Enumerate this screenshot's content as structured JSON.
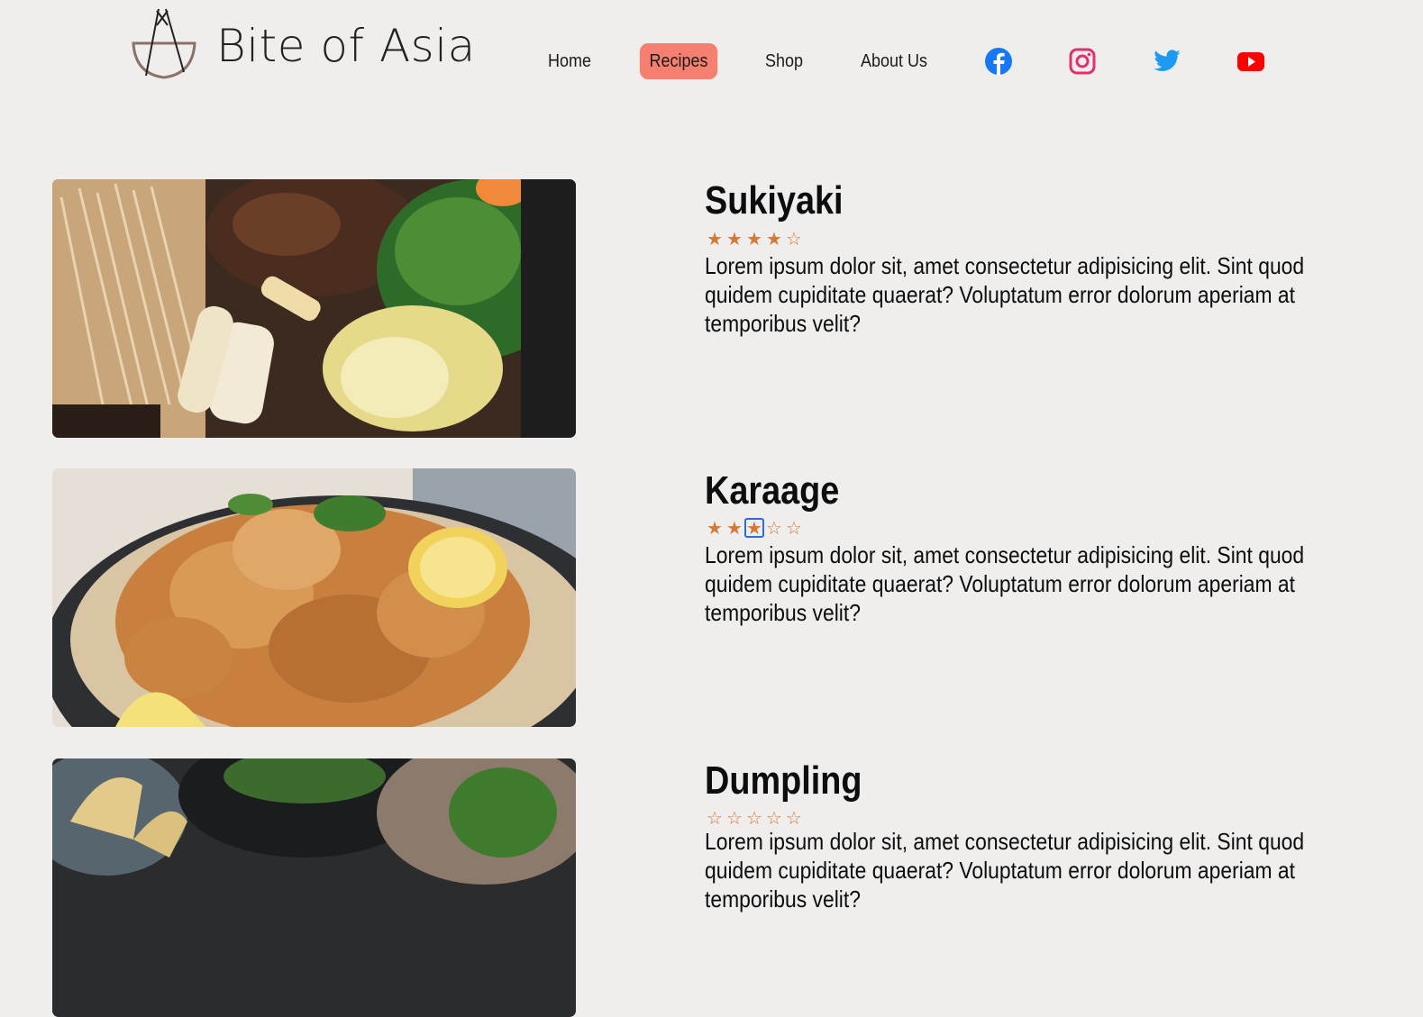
{
  "brand": {
    "name": "Bite of Asia"
  },
  "nav": {
    "items": [
      {
        "label": "Home"
      },
      {
        "label": "Recipes",
        "active": true
      },
      {
        "label": "Shop"
      },
      {
        "label": "About Us"
      }
    ]
  },
  "social": [
    "facebook-icon",
    "instagram-icon",
    "twitter-icon",
    "youtube-icon"
  ],
  "colors": {
    "accent": "#f5806f",
    "star": "#d07a3c",
    "background": "#efeeed"
  },
  "recipes": [
    {
      "title": "Sukiyaki",
      "rating": 4,
      "max_rating": 5,
      "description": "Lorem ipsum dolor sit, amet consectetur adipisicing elit. Sint quod quidem cupiditate quaerat? Voluptatum error dolorum aperiam at temporibus velit?"
    },
    {
      "title": "Karaage",
      "rating": 3,
      "max_rating": 5,
      "description": "Lorem ipsum dolor sit, amet consectetur adipisicing elit. Sint quod quidem cupiditate quaerat? Voluptatum error dolorum aperiam at temporibus velit?"
    },
    {
      "title": "Dumpling",
      "rating": 0,
      "max_rating": 5,
      "description": "Lorem ipsum dolor sit, amet consectetur adipisicing elit. Sint quod quidem cupiditate quaerat? Voluptatum error dolorum aperiam at temporibus velit?"
    }
  ]
}
